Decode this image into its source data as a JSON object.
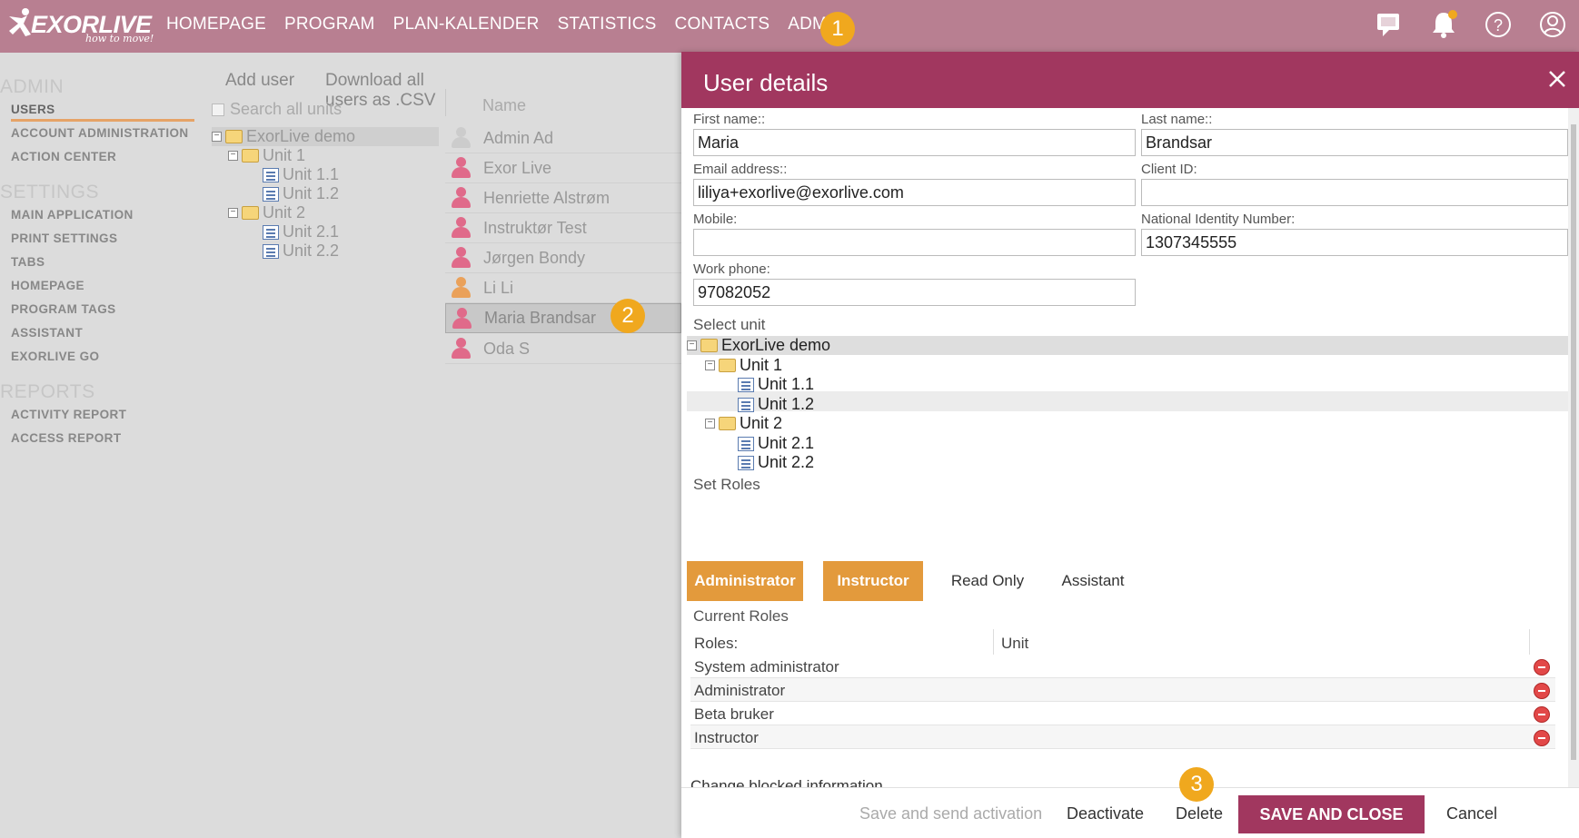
{
  "app": {
    "brand": "EXORLIVE",
    "tagline": "how to move!"
  },
  "nav": {
    "items": [
      "HOMEPAGE",
      "PROGRAM",
      "PLAN-KALENDER",
      "STATISTICS",
      "CONTACTS",
      "ADMIN"
    ]
  },
  "top_icons": [
    "chat-icon",
    "bell-icon",
    "help-icon",
    "user-icon"
  ],
  "badges": [
    "1",
    "2",
    "3"
  ],
  "sidebar": {
    "sections": [
      {
        "title": "ADMIN",
        "items": [
          "USERS",
          "ACCOUNT ADMINISTRATION",
          "ACTION CENTER"
        ]
      },
      {
        "title": "SETTINGS",
        "items": [
          "MAIN APPLICATION",
          "PRINT SETTINGS",
          "TABS",
          "HOMEPAGE",
          "PROGRAM TAGS",
          "ASSISTANT",
          "EXORLIVE GO"
        ]
      },
      {
        "title": "REPORTS",
        "items": [
          "ACTIVITY REPORT",
          "ACCESS REPORT"
        ]
      }
    ],
    "active": "USERS"
  },
  "units_panel": {
    "add_user": "Add user",
    "download_csv": "Download all users as .CSV",
    "search_all_units": "Search all units",
    "tree": {
      "root": "ExorLive demo",
      "unit1": "Unit 1",
      "unit11": "Unit 1.1",
      "unit12": "Unit 1.2",
      "unit2": "Unit 2",
      "unit21": "Unit 2.1",
      "unit22": "Unit 2.2"
    }
  },
  "users_list": {
    "header": "Name",
    "users": [
      "Admin Ad",
      "Exor Live",
      "Henriette Alstrøm",
      "Instruktør Test",
      "Jørgen Bondy",
      "Li Li",
      "Maria Brandsar",
      "Oda S"
    ],
    "selected": "Maria Brandsar"
  },
  "modal": {
    "title": "User details",
    "fields": {
      "first_name_label": "First name::",
      "first_name": "Maria",
      "last_name_label": "Last name::",
      "last_name": "Brandsar",
      "email_label": "Email address::",
      "email": "liliya+exorlive@exorlive.com",
      "client_id_label": "Client ID:",
      "client_id": "",
      "mobile_label": "Mobile:",
      "mobile": "",
      "nin_label": "National Identity Number:",
      "nin": "1307345555",
      "work_phone_label": "Work phone:",
      "work_phone": "97082052"
    },
    "select_unit_label": "Select unit",
    "set_roles_label": "Set Roles",
    "roles": [
      {
        "label": "Administrator",
        "active": true
      },
      {
        "label": "Instructor",
        "active": true
      },
      {
        "label": "Read Only",
        "active": false
      },
      {
        "label": "Assistant",
        "active": false
      }
    ],
    "current_roles_label": "Current Roles",
    "roles_table": {
      "col_roles": "Roles:",
      "col_unit": "Unit",
      "rows": [
        "System administrator",
        "Administrator",
        "Beta bruker",
        "Instructor"
      ]
    },
    "cut_text": "Change blocked information",
    "footer": {
      "save_send": "Save and send activation",
      "deactivate": "Deactivate",
      "delete": "Delete",
      "save_close": "SAVE AND CLOSE",
      "cancel": "Cancel"
    }
  },
  "colors": {
    "topbar": "#b87f91",
    "modal_header": "#a1375f",
    "role_active": "#e39a3c",
    "badge": "#f0a81e"
  }
}
